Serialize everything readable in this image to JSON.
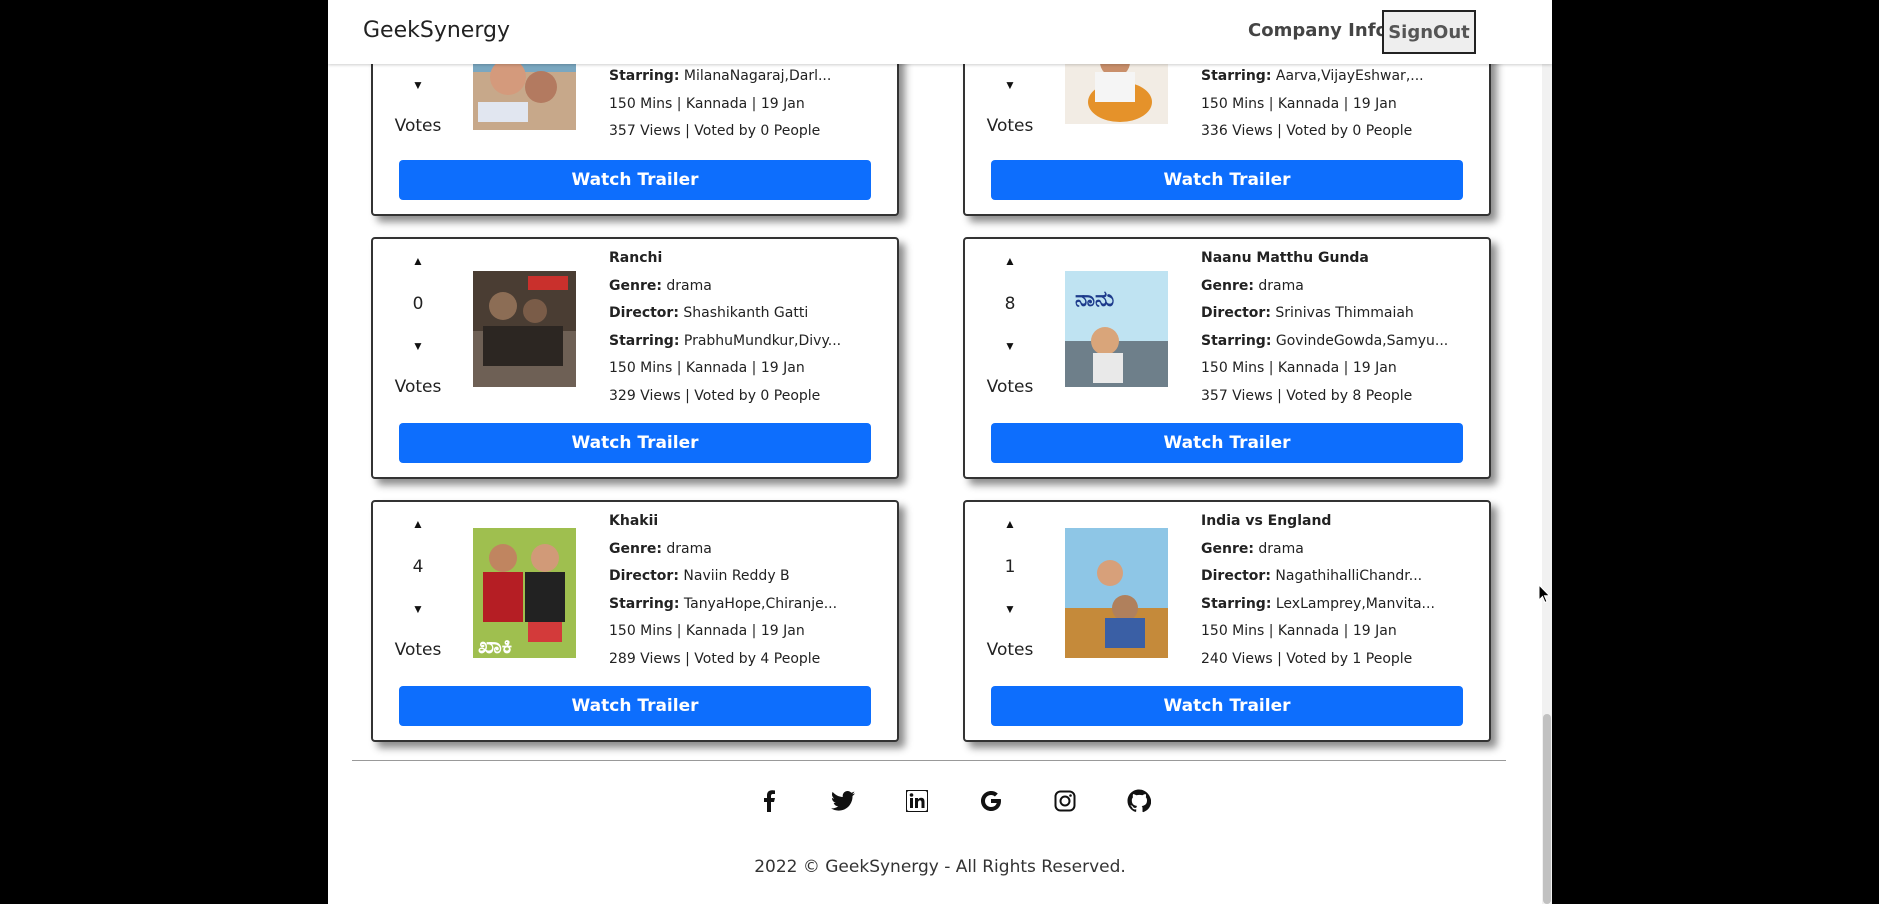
{
  "navbar": {
    "brand": "GeekSynergy",
    "company_info": "Company Info",
    "signout": "SignOut"
  },
  "movies": [
    {
      "title": "",
      "genre": "",
      "director": "",
      "starring": "MilanaNagaraj,Darl...",
      "meta": "150 Mins | Kannada | 19 Jan",
      "stats": "357 Views | Voted by 0 People",
      "votes": "",
      "votes_label": "Votes",
      "trailer": "Watch Trailer"
    },
    {
      "title": "",
      "genre": "",
      "director": "",
      "starring": "Aarva,VijayEshwar,...",
      "meta": "150 Mins | Kannada | 19 Jan",
      "stats": "336 Views | Voted by 0 People",
      "votes": "",
      "votes_label": "Votes",
      "trailer": "Watch Trailer"
    },
    {
      "title": "Ranchi",
      "genre": "drama",
      "director": "Shashikanth Gatti",
      "starring": "PrabhuMundkur,Divy...",
      "meta": "150 Mins | Kannada | 19 Jan",
      "stats": "329 Views | Voted by 0 People",
      "votes": "0",
      "votes_label": "Votes",
      "trailer": "Watch Trailer"
    },
    {
      "title": "Naanu Matthu Gunda",
      "genre": "drama",
      "director": "Srinivas Thimmaiah",
      "starring": "GovindeGowda,Samyu...",
      "meta": "150 Mins | Kannada | 19 Jan",
      "stats": "357 Views | Voted by 8 People",
      "votes": "8",
      "votes_label": "Votes",
      "trailer": "Watch Trailer"
    },
    {
      "title": "Khakii",
      "genre": "drama",
      "director": "Naviin Reddy B",
      "starring": "TanyaHope,Chiranje...",
      "meta": "150 Mins | Kannada | 19 Jan",
      "stats": "289 Views | Voted by 4 People",
      "votes": "4",
      "votes_label": "Votes",
      "trailer": "Watch Trailer"
    },
    {
      "title": "India vs England",
      "genre": "drama",
      "director": "NagathihalliChandr...",
      "starring": "LexLamprey,Manvita...",
      "meta": "150 Mins | Kannada | 19 Jan",
      "stats": "240 Views | Voted by 1 People",
      "votes": "1",
      "votes_label": "Votes",
      "trailer": "Watch Trailer"
    }
  ],
  "labels": {
    "genre": "Genre:",
    "director": "Director:",
    "starring": "Starring:"
  },
  "footer": {
    "copyright": "2022 © GeekSynergy - All Rights Reserved."
  },
  "colors": {
    "primary": "#0d6efd"
  }
}
